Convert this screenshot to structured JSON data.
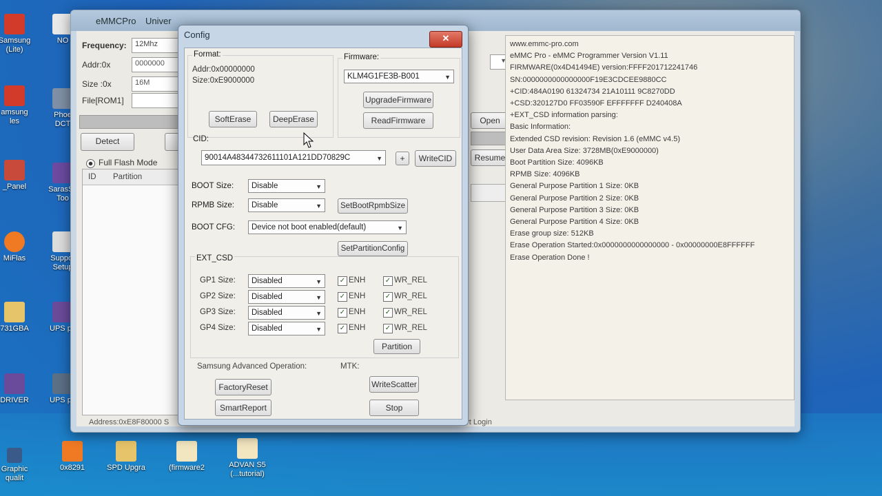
{
  "desktop": {
    "icons": [
      {
        "label": "Samsung\n(Lite)",
        "icon": "samsung-icon"
      },
      {
        "label": "NO",
        "icon": "app-icon"
      },
      {
        "label": "amsung\nles",
        "icon": "samsung-icon"
      },
      {
        "label": "Phoe\nDCT",
        "icon": "app-icon"
      },
      {
        "label": "_Panel",
        "icon": "panel-icon"
      },
      {
        "label": "SarasSc\nToo",
        "icon": "app-icon"
      },
      {
        "label": "MiFlas",
        "icon": "mi-icon"
      },
      {
        "label": "Suppor\nSetup",
        "icon": "app-icon"
      },
      {
        "label": "731GBA",
        "icon": "folder-icon"
      },
      {
        "label": "UPS pa",
        "icon": "archive-icon"
      },
      {
        "label": "DRIVER",
        "icon": "archive-icon"
      },
      {
        "label": "UPS pa",
        "icon": "network-icon"
      },
      {
        "label": "Graphic\nqualit",
        "icon": "shortcut-icon"
      },
      {
        "label": "0x8291",
        "icon": "mi-icon"
      },
      {
        "label": "SPD Upgra",
        "icon": "folder-icon"
      },
      {
        "label": "(firmware2",
        "icon": "folder-icon"
      },
      {
        "label": "ADVAN S5\n(...tutorial)",
        "icon": "folder-icon"
      }
    ]
  },
  "main": {
    "title": "eMMCPro",
    "title_rest": "Univer",
    "frequency_label": "Frequency:",
    "frequency_value": "12Mhz",
    "addr_label": "Addr:0x",
    "addr_value": "0000000",
    "size_label": "Size :0x",
    "size_value": "16M",
    "file_label": "File[ROM1]",
    "detect_label": "Detect",
    "mode_label": "Full Flash Mode",
    "col_id": "ID",
    "col_partition": "Partition",
    "open_label": "Open",
    "resume_label": "Resume",
    "status_text": "Address:0xE8F80000 S",
    "port_login": "ort Login",
    "log": [
      "www.emmc-pro.com",
      "eMMC Pro - eMMC Programmer Version V1.11",
      "FIRMWARE(0x4D41494E) version:FFFF201712241746",
      "SN:0000000000000000F19E3CDCEE9880CC",
      "+CID:484A0190 61324734 21A10111 9C8270DD",
      "+CSD:320127D0 FF03590F EFFFFFFF D240408A",
      "+EXT_CSD information parsing:",
      "Basic Information:",
      "Extended CSD revision: Revision 1.6 (eMMC v4.5)",
      "User Data Area Size: 3728MB(0xE9000000)",
      "Boot Partition Size: 4096KB",
      "RPMB Size: 4096KB",
      "General Purpose Partition 1 Size: 0KB",
      "General Purpose Partition 2 Size: 0KB",
      "General Purpose Partition 3 Size: 0KB",
      "General Purpose Partition 4 Size: 0KB",
      "Erase group size: 512KB",
      "Erase Operation Started:0x0000000000000000 - 0x00000000E8FFFFFF",
      "Erase Operation Done !"
    ]
  },
  "config": {
    "title": "Config",
    "close": "✕",
    "format_label": "Format:",
    "format_addr": "Addr:0x00000000",
    "format_size": "Size:0xE9000000",
    "soft_erase": "SoftErase",
    "deep_erase": "DeepErase",
    "firmware_label": "Firmware:",
    "firmware_value": "KLM4G1FE3B-B001",
    "upgrade_firmware": "UpgradeFirmware",
    "read_firmware": "ReadFirmware",
    "cid_label": "CID:",
    "cid_value": "90014A48344732611101A121DD70829C",
    "plus": "+",
    "write_cid": "WriteCID",
    "boot_size_label": "BOOT Size:",
    "boot_size_value": "Disable",
    "rpmb_size_label": "RPMB Size:",
    "rpmb_size_value": "Disable",
    "set_boot_rpmb": "SetBootRpmbSize",
    "boot_cfg_label": "BOOT CFG:",
    "boot_cfg_value": "Device not boot enabled(default)",
    "set_partition_config": "SetPartitionConfig",
    "ext_csd_label": "EXT_CSD",
    "gp": [
      {
        "label": "GP1 Size:",
        "value": "Disabled"
      },
      {
        "label": "GP2 Size:",
        "value": "Disabled"
      },
      {
        "label": "GP3 Size:",
        "value": "Disabled"
      },
      {
        "label": "GP4 Size:",
        "value": "Disabled"
      }
    ],
    "enh_label": "ENH",
    "wr_rel_label": "WR_REL",
    "check_mark": "✓",
    "partition_button": "Partition",
    "samsung_adv_label": "Samsung Advanced Operation:",
    "mtk_label": "MTK:",
    "factory_reset": "FactoryReset",
    "write_scatter": "WriteScatter",
    "smart_report": "SmartReport",
    "stop": "Stop"
  },
  "colors": {
    "desktop_blue": "#1f63b8",
    "close_red": "#c33a26",
    "dialog_frame": "#c7d6e6"
  }
}
